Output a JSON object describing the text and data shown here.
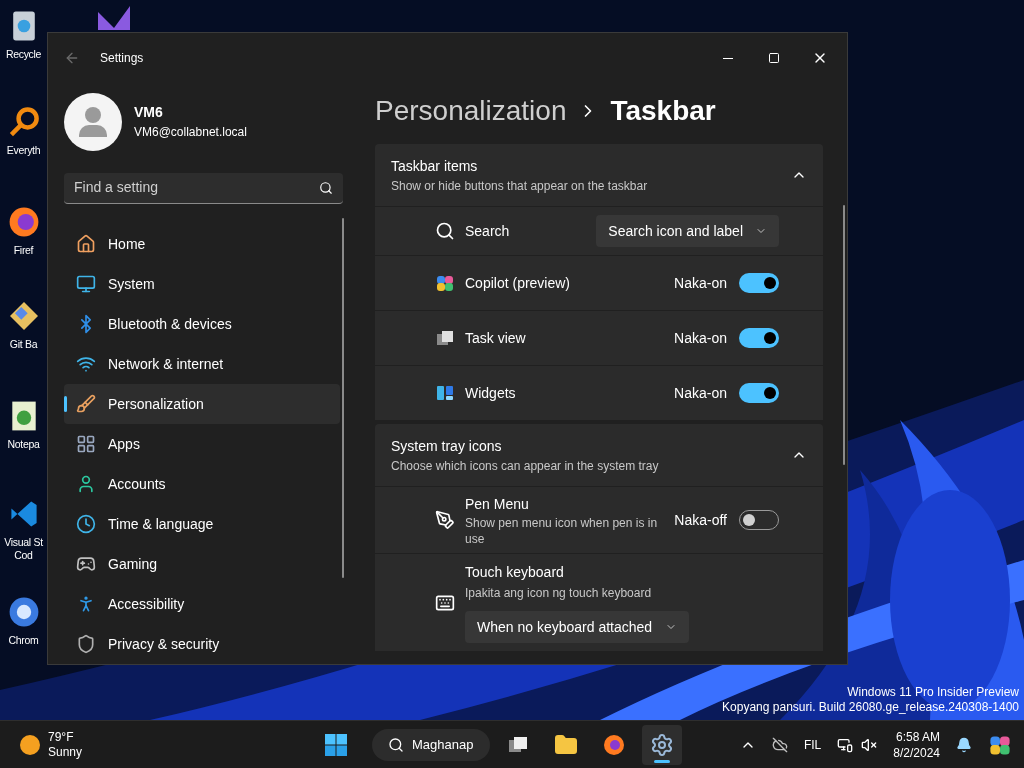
{
  "desktop": {
    "icons": [
      {
        "lines": [
          "Recycle"
        ]
      },
      {
        "lines": [
          "Everyth"
        ]
      },
      {
        "lines": [
          "Firef"
        ]
      },
      {
        "lines": [
          "Git Ba"
        ]
      },
      {
        "lines": [
          "Notepa"
        ]
      },
      {
        "lines": [
          "Visual St",
          "Cod"
        ]
      },
      {
        "lines": [
          "Chrom"
        ]
      }
    ],
    "watermark": [
      "Windows 11 Pro Insider Preview",
      "Kopyang pansuri. Build 26080.ge_release.240308-1400"
    ]
  },
  "window": {
    "title": "Settings",
    "account": {
      "name": "VM6",
      "email": "VM6@collabnet.local"
    },
    "search": {
      "placeholder": "Find a setting"
    },
    "nav": [
      {
        "label": "Home",
        "selected": false
      },
      {
        "label": "System",
        "selected": false
      },
      {
        "label": "Bluetooth & devices",
        "selected": false
      },
      {
        "label": "Network & internet",
        "selected": false
      },
      {
        "label": "Personalization",
        "selected": true
      },
      {
        "label": "Apps",
        "selected": false
      },
      {
        "label": "Accounts",
        "selected": false
      },
      {
        "label": "Time & language",
        "selected": false
      },
      {
        "label": "Gaming",
        "selected": false
      },
      {
        "label": "Accessibility",
        "selected": false
      },
      {
        "label": "Privacy & security",
        "selected": false
      }
    ],
    "breadcrumb": {
      "parent": "Personalization",
      "current": "Taskbar"
    },
    "sections": [
      {
        "title": "Taskbar items",
        "subtitle": "Show or hide buttons that appear on the taskbar",
        "expanded": true,
        "rows": [
          {
            "kind": "dropdown",
            "label": "Search",
            "value": "Search icon and label"
          },
          {
            "kind": "toggle",
            "label": "Copilot (preview)",
            "state_label": "Naka-on",
            "on": true
          },
          {
            "kind": "toggle",
            "label": "Task view",
            "state_label": "Naka-on",
            "on": true
          },
          {
            "kind": "toggle",
            "label": "Widgets",
            "state_label": "Naka-on",
            "on": true
          }
        ]
      },
      {
        "title": "System tray icons",
        "subtitle": "Choose which icons can appear in the system tray",
        "expanded": true,
        "rows": [
          {
            "kind": "toggle",
            "label": "Pen Menu",
            "description": "Show pen menu icon when pen is in use",
            "state_label": "Naka-off",
            "on": false
          },
          {
            "kind": "dropdown_below",
            "label": "Touch keyboard",
            "description": "Ipakita ang icon ng touch keyboard",
            "value": "When no keyboard attached"
          }
        ]
      }
    ]
  },
  "taskbar": {
    "weather": {
      "temp": "79°F",
      "condition": "Sunny"
    },
    "search": "Maghanap",
    "apps": [
      {
        "selected": false
      },
      {
        "selected": false
      },
      {
        "selected": false
      },
      {
        "selected": true
      }
    ],
    "language": "FIL",
    "time": "6:58 AM",
    "date": "8/2/2024"
  }
}
